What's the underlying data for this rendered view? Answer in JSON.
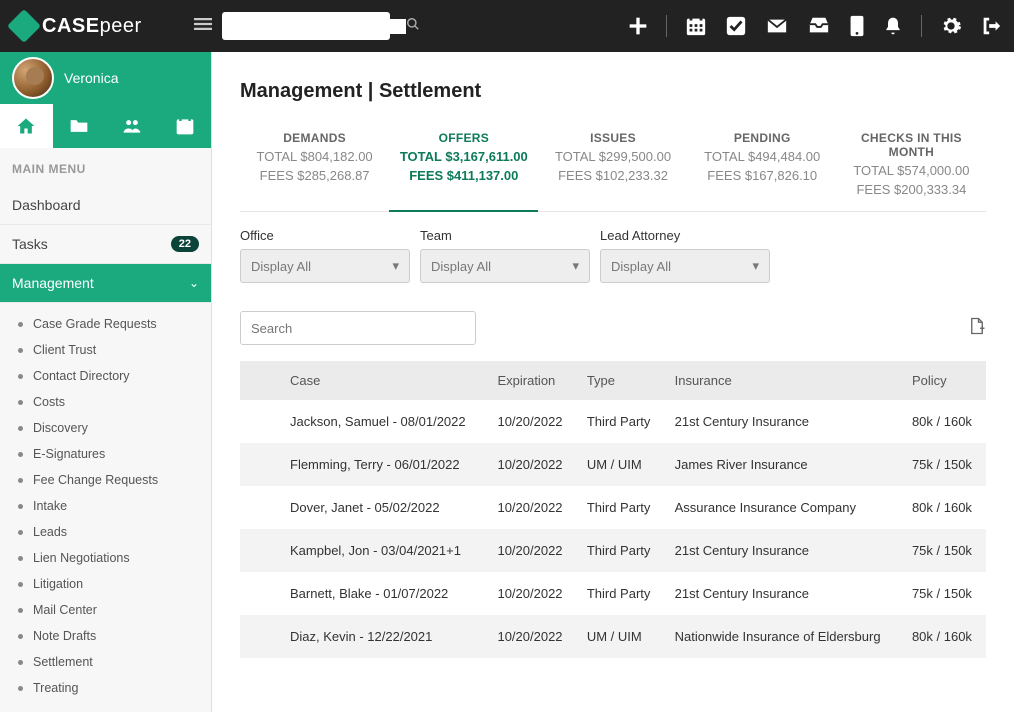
{
  "brand": {
    "name_bold": "CASE",
    "name_light": "peer"
  },
  "user": {
    "name": "Veronica"
  },
  "main_menu_label": "MAIN MENU",
  "menu": {
    "dashboard": "Dashboard",
    "tasks": "Tasks",
    "tasks_badge": "22",
    "management": "Management"
  },
  "sub_items": [
    "Case Grade Requests",
    "Client Trust",
    "Contact Directory",
    "Costs",
    "Discovery",
    "E-Signatures",
    "Fee Change Requests",
    "Intake",
    "Leads",
    "Lien Negotiations",
    "Litigation",
    "Mail Center",
    "Note Drafts",
    "Settlement",
    "Treating"
  ],
  "page_title": "Management | Settlement",
  "stats": [
    {
      "label": "DEMANDS",
      "total": "TOTAL $804,182.00",
      "fees": "FEES  $285,268.87"
    },
    {
      "label": "OFFERS",
      "total": "TOTAL $3,167,611.00",
      "fees": "FEES $411,137.00"
    },
    {
      "label": "ISSUES",
      "total": "TOTAL $299,500.00",
      "fees": "FEES $102,233.32"
    },
    {
      "label": "PENDING",
      "total": "TOTAL $494,484.00",
      "fees": "FEES $167,826.10"
    },
    {
      "label": "CHECKS IN THIS MONTH",
      "total": "TOTAL $574,000.00",
      "fees": "FEES $200,333.34"
    }
  ],
  "filters": {
    "office": {
      "label": "Office",
      "value": "Display All"
    },
    "team": {
      "label": "Team",
      "value": "Display All"
    },
    "attorney": {
      "label": "Lead Attorney",
      "value": "Display All"
    }
  },
  "table_search_placeholder": "Search",
  "columns": {
    "case": "Case",
    "exp": "Expiration",
    "type": "Type",
    "ins": "Insurance",
    "policy": "Policy"
  },
  "rows": [
    {
      "case": "Jackson, Samuel - 08/01/2022",
      "exp": "10/20/2022",
      "type": "Third Party",
      "ins": "21st Century Insurance",
      "policy": "80k / 160k"
    },
    {
      "case": "Flemming, Terry - 06/01/2022",
      "exp": "10/20/2022",
      "type": "UM / UIM",
      "ins": "James River Insurance",
      "policy": "75k / 150k"
    },
    {
      "case": "Dover, Janet - 05/02/2022",
      "exp": "10/20/2022",
      "type": "Third Party",
      "ins": "Assurance Insurance Company",
      "policy": "80k / 160k"
    },
    {
      "case": "Kampbel, Jon - 03/04/2021+1",
      "exp": "10/20/2022",
      "type": "Third Party",
      "ins": "21st Century Insurance",
      "policy": "75k / 150k"
    },
    {
      "case": "Barnett, Blake - 01/07/2022",
      "exp": "10/20/2022",
      "type": "Third Party",
      "ins": "21st Century Insurance",
      "policy": "75k / 150k"
    },
    {
      "case": "Diaz, Kevin - 12/22/2021",
      "exp": "10/20/2022",
      "type": "UM / UIM",
      "ins": "Nationwide Insurance of Eldersburg",
      "policy": "80k / 160k"
    }
  ]
}
